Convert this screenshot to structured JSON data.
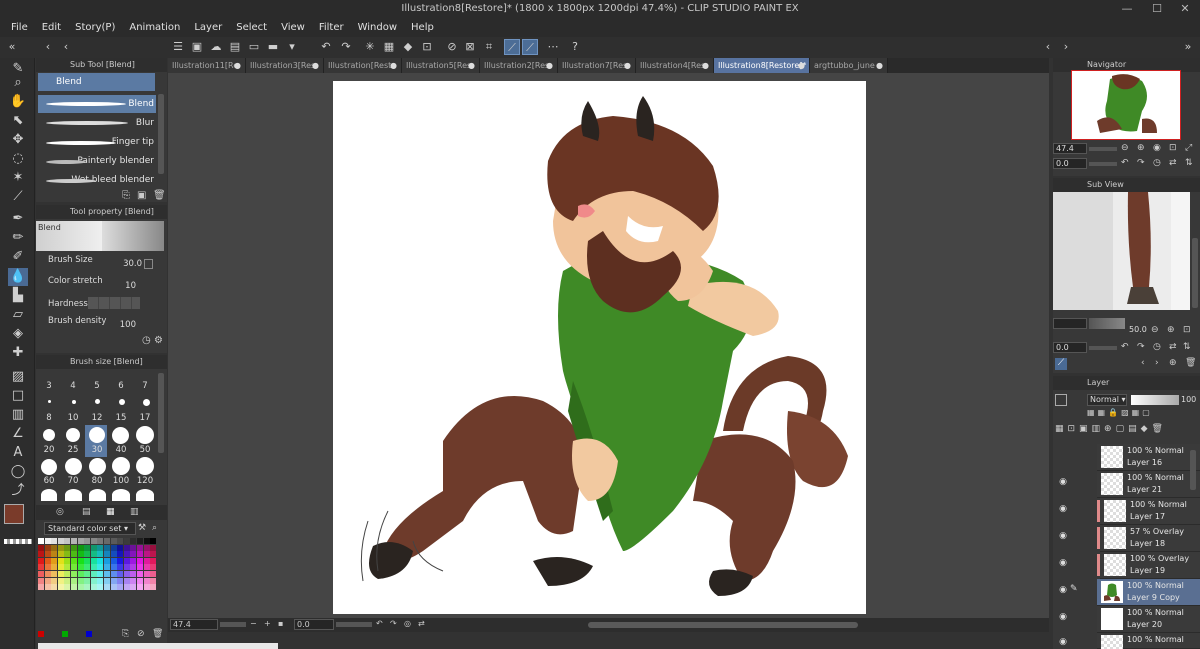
{
  "window": {
    "title": "Illustration8[Restore]* (1800 x 1800px 1200dpi 47.4%)  - CLIP STUDIO PAINT EX",
    "minimize": "—",
    "maximize": "☐",
    "close": "✕"
  },
  "menu": [
    "File",
    "Edit",
    "Story(P)",
    "Animation",
    "Layer",
    "Select",
    "View",
    "Filter",
    "Window",
    "Help"
  ],
  "tabs": [
    {
      "label": "Illustration11[Re",
      "active": false
    },
    {
      "label": "Illustration3[Res",
      "active": false
    },
    {
      "label": "Illustration[Rest",
      "active": false
    },
    {
      "label": "Illustration5[Res",
      "active": false
    },
    {
      "label": "Illustration2[Res",
      "active": false
    },
    {
      "label": "Illustration7[Res",
      "active": false
    },
    {
      "label": "Illustration4[Res",
      "active": false
    },
    {
      "label": "Illustration8[Restore]*",
      "active": true
    },
    {
      "label": "argttubbo_june",
      "active": false
    }
  ],
  "subtool": {
    "title": "Sub Tool [Blend]",
    "group": "Blend",
    "brushes": [
      "Blend",
      "Blur",
      "Finger tip",
      "Painterly blender",
      "Wet bleed blender"
    ],
    "selected": "Blend"
  },
  "toolprop": {
    "title": "Tool property [Blend]",
    "preview_label": "Blend",
    "brush_size_label": "Brush Size",
    "brush_size": "30.0",
    "color_stretch_label": "Color stretch",
    "color_stretch": "10",
    "hardness_label": "Hardness",
    "brush_density_label": "Brush density",
    "brush_density": "100"
  },
  "brushsize": {
    "title": "Brush size [Blend]",
    "sizes": [
      "3",
      "4",
      "5",
      "6",
      "7",
      "8",
      "10",
      "12",
      "15",
      "17",
      "20",
      "25",
      "30",
      "40",
      "50",
      "60",
      "70",
      "80",
      "100",
      "120"
    ],
    "selected": "30"
  },
  "colorset": {
    "name": "Standard color set",
    "main_color": "#7a3b2a",
    "sub_color": "#2a1a14"
  },
  "navigator": {
    "title": "Navigator",
    "zoom": "47.4",
    "angle": "0.0"
  },
  "subview": {
    "title": "Sub View",
    "zoom": "50.0",
    "angle": "0.0"
  },
  "layer": {
    "title": "Layer",
    "blend_mode": "Normal",
    "opacity": "100",
    "layers": [
      {
        "mode": "100 % Normal",
        "name": "Layer 16",
        "visible": false,
        "clip": false,
        "selected": false
      },
      {
        "mode": "100 % Normal",
        "name": "Layer 21",
        "visible": true,
        "clip": false,
        "selected": false
      },
      {
        "mode": "100 % Normal",
        "name": "Layer 17",
        "visible": true,
        "clip": true,
        "selected": false
      },
      {
        "mode": "57 % Overlay",
        "name": "Layer 18",
        "visible": true,
        "clip": true,
        "selected": false
      },
      {
        "mode": "100 % Overlay",
        "name": "Layer 19",
        "visible": true,
        "clip": true,
        "selected": false
      },
      {
        "mode": "100 % Normal",
        "name": "Layer 9 Copy",
        "visible": true,
        "clip": false,
        "selected": true
      },
      {
        "mode": "100 % Normal",
        "name": "Layer 20",
        "visible": true,
        "clip": false,
        "selected": false
      },
      {
        "mode": "100 % Normal",
        "name": "",
        "visible": true,
        "clip": false,
        "selected": false
      }
    ]
  },
  "status": {
    "zoom": "47.4",
    "angle": "0.0"
  }
}
